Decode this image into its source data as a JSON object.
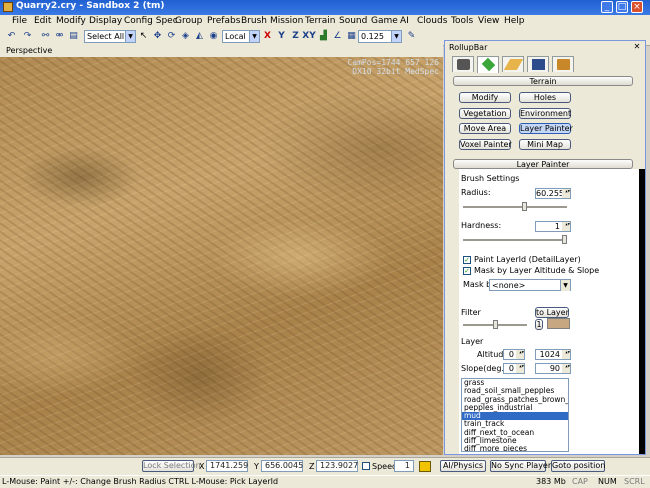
{
  "window": {
    "title": "Quarry2.cry - Sandbox 2 (tm)"
  },
  "menu": [
    "File",
    "Edit",
    "Modify",
    "Display",
    "Config Spec",
    "Group",
    "Prefabs",
    "Brush",
    "Mission",
    "Terrain",
    "Sound",
    "Game",
    "AI",
    "Clouds",
    "Tools",
    "View",
    "Help"
  ],
  "toolbar": {
    "selection_filter": "Select All",
    "coord_system": "Local",
    "axes": [
      "X",
      "Y",
      "Z",
      "XY"
    ],
    "snap_value": "0.125"
  },
  "viewport": {
    "label": "Perspective",
    "campos_line1": "CamPos=1744 657 126",
    "campos_line2": "DX10 32bit MedSpec"
  },
  "rollup": {
    "title": "RollupBar",
    "close_icon": "close-icon",
    "tabs": [
      "objects-tab-icon",
      "terrain-tab-icon",
      "modeling-tab-icon",
      "display-tab-icon",
      "layers-tab-icon"
    ],
    "terrain_header": "Terrain",
    "buttons": [
      {
        "label": "Modify",
        "active": false
      },
      {
        "label": "Holes",
        "active": false
      },
      {
        "label": "Vegetation",
        "active": false
      },
      {
        "label": "Environment",
        "active": false
      },
      {
        "label": "Move Area",
        "active": false
      },
      {
        "label": "Layer Painter",
        "active": true
      },
      {
        "label": "Voxel Painter",
        "active": false
      },
      {
        "label": "Mini Map",
        "active": false
      }
    ],
    "layer_painter_header": "Layer Painter",
    "brush_settings_label": "Brush Settings",
    "radius_label": "Radius:",
    "radius_value": "60.255",
    "radius_level": 0.6,
    "hardness_label": "Hardness:",
    "hardness_value": "1",
    "hardness_level": 1.0,
    "paint_layer_id_label": "Paint LayerId (DetailLayer)",
    "mask_altitude_label": "Mask by Layer Altitude & Slope",
    "mask_by_label": "Mask by",
    "mask_by_value": "<none>",
    "filter_label": "Filter",
    "to_layer_label": "to Layer",
    "filter_number": "1",
    "filter_color": "#c7a781",
    "layer_label": "Layer",
    "altitude_label": "Altitude",
    "altitude_min": "0",
    "altitude_max": "1024",
    "slope_label": "Slope(deg.)",
    "slope_min": "0",
    "slope_max": "90",
    "layers": [
      "grass",
      "road_soil_small_pepples",
      "road_grass_patches_brown_soil",
      "pepples_industrial",
      "mud",
      "train_track",
      "diff_next_to_ocean",
      "diff_limestone",
      "diff_more_pieces"
    ],
    "selected_layer": "mud"
  },
  "bottom": {
    "lock_selection": "Lock Selection",
    "x_label": "X",
    "x_value": "1741.259",
    "y_label": "Y",
    "y_value": "656.0045",
    "z_label": "Z",
    "z_value": "123.9027",
    "speed_label": "Speed:",
    "speed_value": "1",
    "ai_physics": "AI/Physics",
    "no_sync_player": "No Sync Player",
    "goto_position": "Goto position"
  },
  "status": {
    "hint": "L-Mouse: Paint   +/-: Change Brush Radius   CTRL L-Mouse: Pick LayerId",
    "memory": "383 Mb",
    "cap": "CAP",
    "num": "NUM",
    "scrl": "SCRL"
  }
}
